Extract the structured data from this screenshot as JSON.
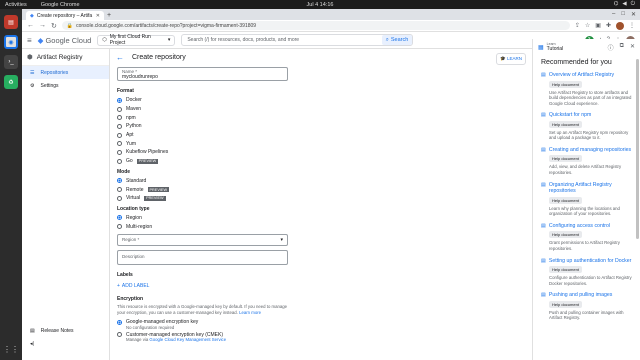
{
  "os": {
    "activities": "Activities",
    "app": "Google Chrome",
    "clock": "Jul 4  14:16"
  },
  "browser": {
    "tab_title": "Create repository – Artifa",
    "url": "console.cloud.google.com/artifacts/create-repo?project=vigma-firmament-391809"
  },
  "gc": {
    "logo": "Google Cloud",
    "project": "My first Cloud Run Project",
    "search_placeholder": "Search (/) for resources, docs, products, and more",
    "search_btn": "Search",
    "badge": "3"
  },
  "sidenav": {
    "title": "Artifact Registry",
    "items": [
      "Repositories",
      "Settings"
    ],
    "bottom": "Release Notes"
  },
  "main": {
    "title": "Create repository",
    "learn": "LEARN",
    "name_label": "Name *",
    "name_value": "mycloudrunrepo",
    "format_label": "Format",
    "formats": [
      "Docker",
      "Maven",
      "npm",
      "Python",
      "Apt",
      "Yum",
      "Kubeflow Pipelines",
      "Go"
    ],
    "preview": "PREVIEW",
    "mode_label": "Mode",
    "modes": [
      "Standard",
      "Remote",
      "Virtual"
    ],
    "location_label": "Location type",
    "locations": [
      "Region",
      "Multi-region"
    ],
    "region_label": "Region *",
    "description_label": "Description",
    "labels_label": "Labels",
    "add_label": "ADD LABEL",
    "encryption_label": "Encryption",
    "encryption_text": "This resource is encrypted with a Google-managed key by default. If you need to manage your encryption, you can use a customer-managed key instead.",
    "learn_more": "Learn more",
    "enc1": "Google-managed encryption key",
    "enc1_sub": "No configuration required",
    "enc2": "Customer-managed encryption key (CMEK)",
    "enc2_sub_pre": "Manage via",
    "enc2_sub_link": "Google Cloud Key Management Service"
  },
  "panel": {
    "tut_small": "Learn",
    "tutorial": "Tutorial",
    "title": "Recommended for you",
    "tag": "Help document",
    "cards": [
      {
        "t": "Overview of Artifact Registry",
        "d": "Use Artifact Registry to store artifacts and build dependencies as part of an integrated Google Cloud experience."
      },
      {
        "t": "Quickstart for npm",
        "d": "Set up an Artifact Registry npm repository and upload a package to it."
      },
      {
        "t": "Creating and managing repositories",
        "d": "Add, view, and delete Artifact Registry repositories."
      },
      {
        "t": "Organizing Artifact Registry repositories",
        "d": "Learn why planning the locations and organization of your repositories."
      },
      {
        "t": "Configuring access control",
        "d": "Grant permissions to Artifact Registry repositories."
      },
      {
        "t": "Setting up authentication for Docker",
        "d": "Configure authentication to Artifact Registry Docker repositories."
      },
      {
        "t": "Pushing and pulling images",
        "d": "Push and pulling container images with Artifact Registry."
      }
    ]
  }
}
